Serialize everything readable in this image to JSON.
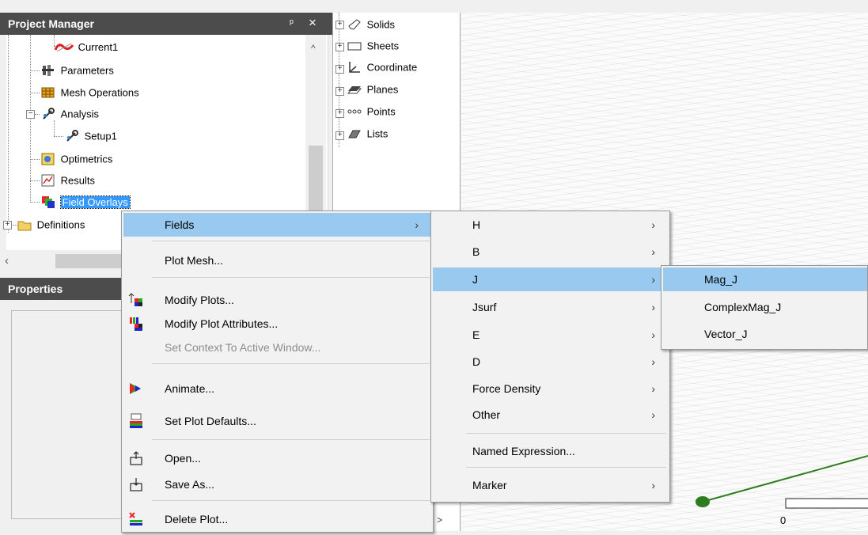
{
  "project_manager": {
    "title": "Project Manager",
    "pin_glyph": "ᵖ",
    "close_glyph": "✕",
    "items": [
      {
        "label": "Current1"
      },
      {
        "label": "Parameters"
      },
      {
        "label": "Mesh Operations"
      },
      {
        "label": "Analysis"
      },
      {
        "label": "Setup1"
      },
      {
        "label": "Optimetrics"
      },
      {
        "label": "Results"
      },
      {
        "label": "Field Overlays"
      },
      {
        "label": "Definitions"
      }
    ]
  },
  "properties": {
    "title": "Properties"
  },
  "model_tree": {
    "items": [
      {
        "label": "Solids"
      },
      {
        "label": "Sheets"
      },
      {
        "label": "Coordinate"
      },
      {
        "label": "Planes"
      },
      {
        "label": "Points"
      },
      {
        "label": "Lists"
      }
    ]
  },
  "view": {
    "scale_label": "0"
  },
  "context_menu": {
    "items": [
      {
        "label": "Fields"
      },
      {
        "label": "Plot Mesh..."
      },
      {
        "label": "Modify Plots..."
      },
      {
        "label": "Modify Plot Attributes..."
      },
      {
        "label": "Set Context To Active Window..."
      },
      {
        "label": "Animate..."
      },
      {
        "label": "Set Plot Defaults..."
      },
      {
        "label": "Open..."
      },
      {
        "label": "Save As..."
      },
      {
        "label": "Delete Plot..."
      }
    ]
  },
  "fields_menu": {
    "items": [
      {
        "label": "H"
      },
      {
        "label": "B"
      },
      {
        "label": "J"
      },
      {
        "label": "Jsurf"
      },
      {
        "label": "E"
      },
      {
        "label": "D"
      },
      {
        "label": "Force Density"
      },
      {
        "label": "Other"
      },
      {
        "label": "Named Expression..."
      },
      {
        "label": "Marker"
      }
    ]
  },
  "j_menu": {
    "items": [
      {
        "label": "Mag_J"
      },
      {
        "label": "ComplexMag_J"
      },
      {
        "label": "Vector_J"
      }
    ]
  },
  "colors": {
    "titlebar": "#4c4c4c",
    "menu_highlight": "#99c9ef",
    "selection": "#3399ff",
    "plot_line": "#2e7d1e"
  }
}
